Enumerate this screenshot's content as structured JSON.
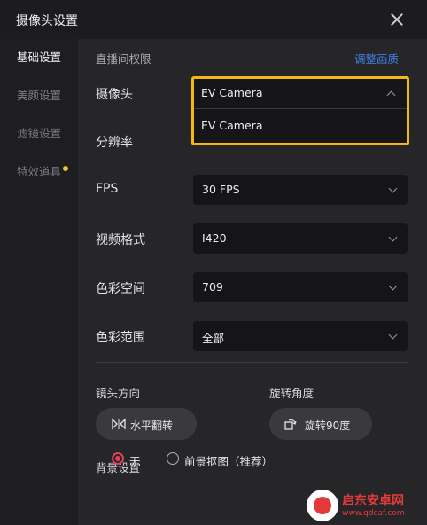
{
  "window": {
    "title": "摄像头设置"
  },
  "sidebar": {
    "items": [
      {
        "label": "基础设置",
        "active": true
      },
      {
        "label": "美颜设置",
        "active": false
      },
      {
        "label": "滤镜设置",
        "active": false
      },
      {
        "label": "特效道具",
        "active": false,
        "badge_dot": true
      }
    ]
  },
  "main": {
    "section_title": "直播间权限",
    "adjust_link": "调整画质",
    "camera": {
      "label": "摄像头",
      "value": "EV Camera",
      "options": [
        "EV Camera"
      ]
    },
    "resolution": {
      "label": "分辨率"
    },
    "fps": {
      "label": "FPS",
      "value": "30 FPS"
    },
    "video_format": {
      "label": "视频格式",
      "value": "I420"
    },
    "color_space": {
      "label": "色彩空间",
      "value": "709"
    },
    "color_range": {
      "label": "色彩范围",
      "value": "全部"
    },
    "lens_direction": {
      "label": "镜头方向",
      "button": "水平翻转"
    },
    "rotation": {
      "label": "旋转角度",
      "button": "旋转90度"
    },
    "background": {
      "label": "背景设置",
      "options": [
        {
          "label": "无",
          "selected": true
        },
        {
          "label": "前景抠图（推荐）",
          "selected": false
        }
      ]
    }
  },
  "watermark": {
    "title": "启东安卓网",
    "url": "www.qdcaf.com"
  },
  "colors": {
    "highlight": "#f5b716",
    "link": "#3d82e6",
    "radio_accent": "#e0405a",
    "badge_dot": "#f2c230"
  }
}
